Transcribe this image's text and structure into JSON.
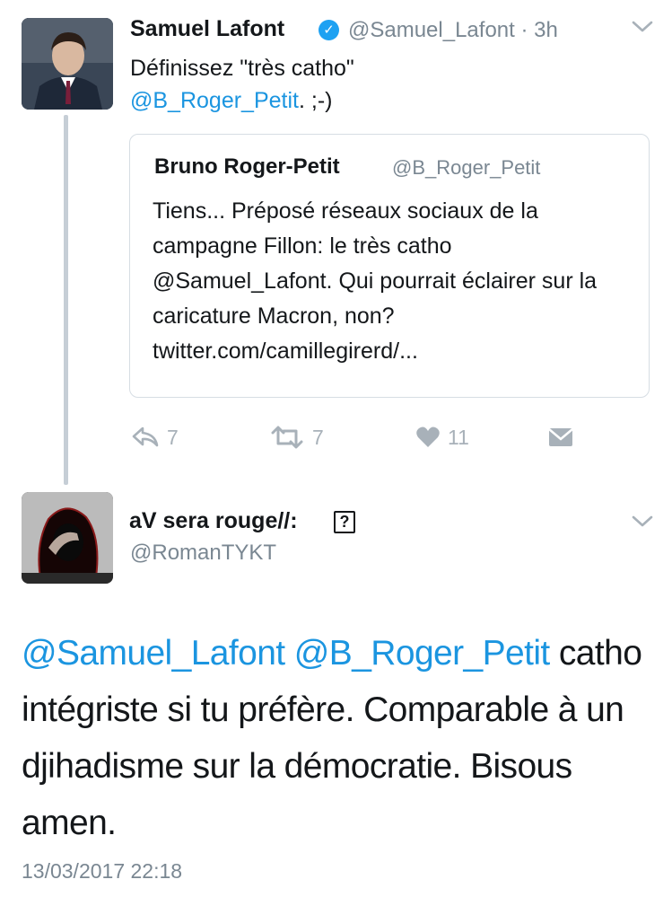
{
  "tweet": {
    "author_name": "Samuel Lafont",
    "author_handle": "@Samuel_Lafont",
    "time_sep": " · ",
    "time": "3h",
    "text_line1": "Définissez \"très catho\"",
    "mention": "@B_Roger_Petit",
    "text_suffix": ". ;-)",
    "quote": {
      "author_name": "Bruno Roger-Petit",
      "author_handle": "@B_Roger_Petit",
      "text": "Tiens... Préposé réseaux sociaux de la campagne Fillon: le très catho @Samuel_Lafont. Qui pourrait éclairer sur la caricature Macron, non? twitter.com/camillegirerd/..."
    },
    "actions": {
      "reply_count": "7",
      "retweet_count": "7",
      "like_count": "11"
    }
  },
  "reply": {
    "author_name": "aV sera rouge//:",
    "author_emoji": "?",
    "author_handle": "@RomanTYKT",
    "mention1": "@Samuel_Lafont",
    "mention2": "@B_Roger_Petit",
    "text": " catho intégriste si tu préfère. Comparable à un djihadisme sur la démocratie. Bisous amen.",
    "timestamp": "13/03/2017 22:18"
  },
  "colors": {
    "link": "#1b95e0",
    "muted": "#7a8792",
    "icon": "#a8b1b9",
    "verified": "#1da1f2"
  }
}
